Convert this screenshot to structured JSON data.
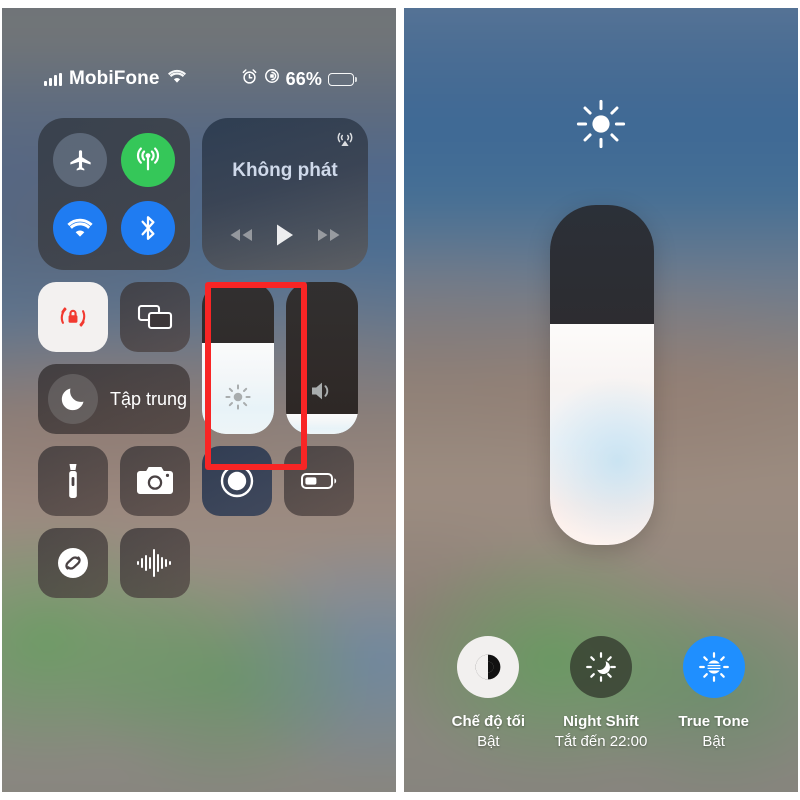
{
  "status_bar": {
    "carrier": "MobiFone",
    "signal_bars": 4,
    "wifi_icon": "wifi-icon",
    "alarm_icon": "alarm-clock-icon",
    "rotation_lock_icon": "rotation-lock-icon",
    "battery_percent": "66%",
    "battery_level": 66
  },
  "control_center": {
    "connectivity": {
      "airplane": {
        "name": "airplane-mode",
        "state": "off"
      },
      "cellular": {
        "name": "cellular-data",
        "state": "on",
        "color": "#35c759"
      },
      "wifi": {
        "name": "wifi",
        "state": "on",
        "color": "#1f7cf2"
      },
      "bluetooth": {
        "name": "bluetooth",
        "state": "on",
        "color": "#1f7cf2"
      }
    },
    "media": {
      "title": "Không phát",
      "airplay_icon": "airplay-icon",
      "prev_label": "rewind",
      "play_label": "play",
      "next_label": "fast-forward"
    },
    "rotation_lock": {
      "label": "rotation-lock",
      "state": "on"
    },
    "screen_mirroring": {
      "label": "screen-mirroring"
    },
    "focus": {
      "label": "Tập trung",
      "icon": "moon-icon"
    },
    "brightness_slider": {
      "label": "brightness",
      "value": 60,
      "highlighted": true
    },
    "volume_slider": {
      "label": "volume",
      "value": 13
    },
    "flashlight": {
      "label": "flashlight"
    },
    "camera": {
      "label": "camera"
    },
    "screen_record": {
      "label": "screen-record",
      "state": "on"
    },
    "low_power": {
      "label": "low-power-mode"
    },
    "shazam": {
      "label": "shazam"
    },
    "voice_memo": {
      "label": "sound-recognition"
    }
  },
  "brightness_panel": {
    "sun_icon": "sun-icon",
    "slider": {
      "label": "brightness-expanded",
      "value": 65
    },
    "options": [
      {
        "name": "dark-mode",
        "icon": "dark-mode-icon",
        "label": "Chế độ tối",
        "state": "Bật"
      },
      {
        "name": "night-shift",
        "icon": "night-shift-icon",
        "label": "Night Shift",
        "state": "Tắt đến 22:00"
      },
      {
        "name": "true-tone",
        "icon": "true-tone-icon",
        "label": "True Tone",
        "state": "Bật"
      }
    ]
  },
  "colors": {
    "highlight": "#f82525",
    "accent_blue": "#1f7cf2",
    "accent_green": "#35c759",
    "true_tone_blue": "#1f8fff"
  }
}
